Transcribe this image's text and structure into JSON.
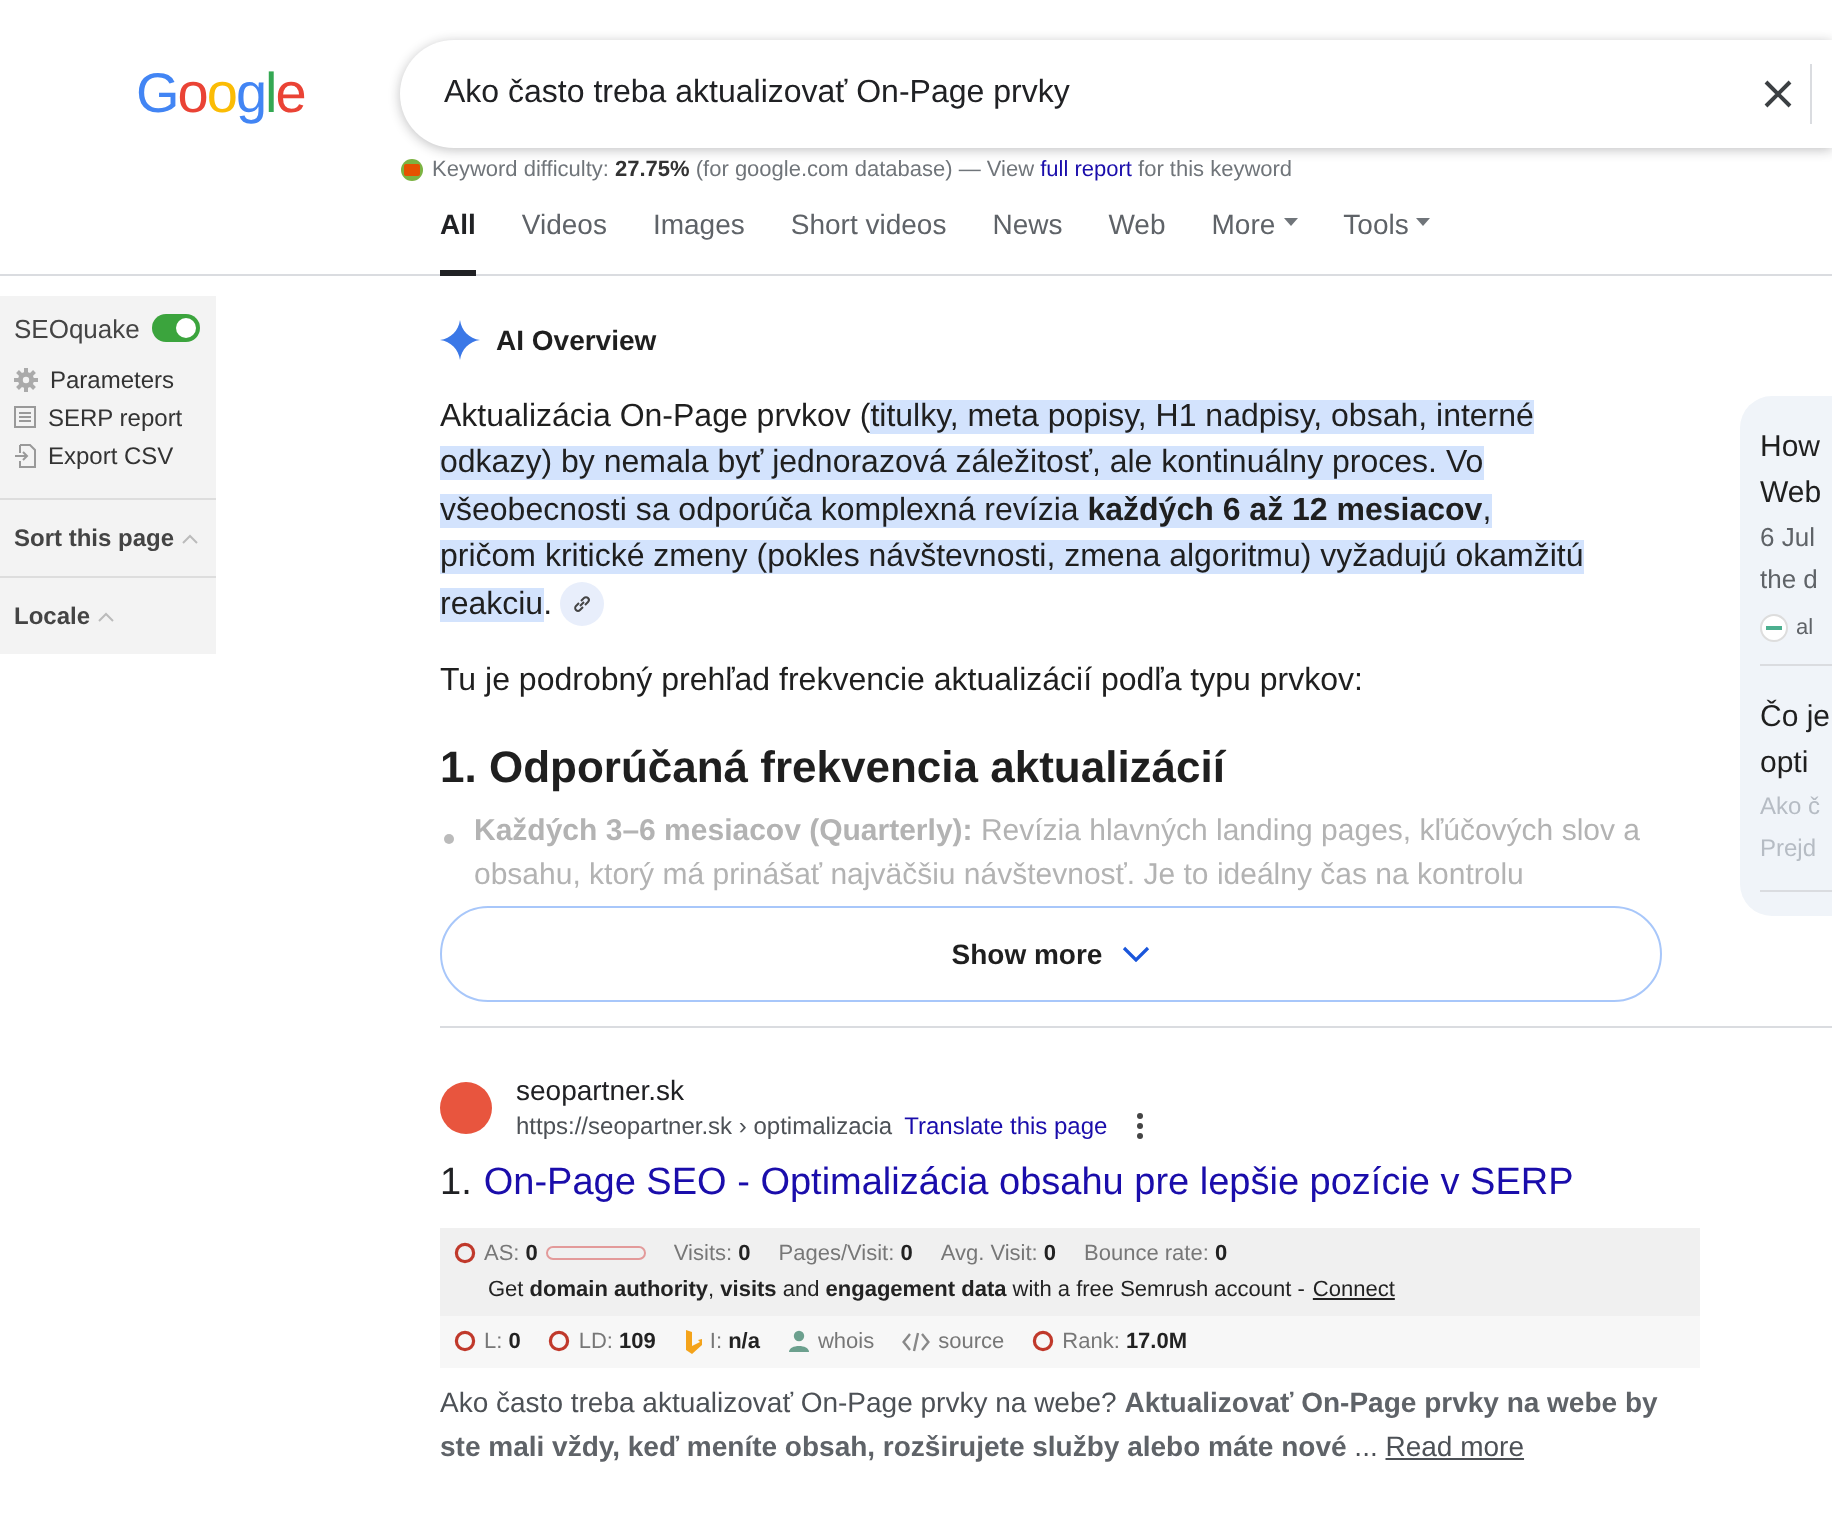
{
  "header": {
    "logo": "Google",
    "query": "Ako často treba aktualizovať On-Page prvky"
  },
  "keyword_difficulty": {
    "before": "Keyword difficulty: **27.75%** (for google.com database) — View",
    "link": "full report",
    "after": "for this keyword"
  },
  "tabs": [
    {
      "label": "All",
      "selected": true,
      "kind": "plain"
    },
    {
      "label": "Videos",
      "selected": false,
      "kind": "plain"
    },
    {
      "label": "Images",
      "selected": false,
      "kind": "plain"
    },
    {
      "label": "Short videos",
      "selected": false,
      "kind": "plain"
    },
    {
      "label": "News",
      "selected": false,
      "kind": "plain"
    },
    {
      "label": "Web",
      "selected": false,
      "kind": "plain"
    },
    {
      "label": "More",
      "selected": false,
      "kind": "dropdown"
    },
    {
      "label": "Tools",
      "selected": false,
      "kind": "dropdown"
    }
  ],
  "seoquake_panel": {
    "title": "SEOquake",
    "on": true,
    "items": [
      {
        "label": "Parameters",
        "kind": "gear"
      },
      {
        "label": "SERP report",
        "kind": "list"
      },
      {
        "label": "Export CSV",
        "kind": "export"
      }
    ],
    "sections": [
      {
        "label": "Sort this page"
      },
      {
        "label": "Locale"
      }
    ]
  },
  "ai_overview": {
    "title": "AI Overview",
    "paragraph": [
      {
        "text": "Aktualizácia On-Page prvkov (",
        "highlighted": false
      },
      {
        "text": "titulky, meta popisy, H1 nadpisy, obsah, interné odkazy) by nemala byť jednorazová záležitosť, ale kontinuálny proces. Vo všeobecnosti sa odporúča komplexná revízia **každých 6 až 12 mesiacov**, pričom kritické zmeny (pokles návštevnosti, zmena algoritmu) vyžadujú okamžitú reakciu",
        "highlighted": true
      },
      {
        "text": ".",
        "highlighted": false
      }
    ],
    "intro": "Tu je podrobný prehľad frekvencie aktualizácií podľa typu prvkov:",
    "heading": "1. Odporúčaná frekvencia aktualizácií",
    "bullet": "**Každých 3–6 mesiacov (Quarterly):** Revízia hlavných landing pages, kľúčových slov a obsahu, ktorý má prinášať najväčšiu návštevnosť. Je to ideálny čas na kontrolu",
    "show_more": "Show more"
  },
  "side_cards": [
    {
      "lines": [
        {
          "kind": "title",
          "text": "How"
        },
        {
          "kind": "title",
          "text": "Web"
        },
        {
          "kind": "meta",
          "text": "6 Jul"
        },
        {
          "kind": "meta",
          "text": "the d"
        },
        {
          "kind": "source",
          "text": "al"
        }
      ]
    },
    {
      "lines": [
        {
          "kind": "title",
          "text": "Čo je"
        },
        {
          "kind": "title",
          "text": "opti"
        },
        {
          "kind": "faded",
          "text": "Ako č"
        },
        {
          "kind": "faded",
          "text": "Prejd"
        }
      ]
    }
  ],
  "result": {
    "site": "seopartner.sk",
    "url": "https://seopartner.sk › optimalizacia",
    "translate": "Translate this page",
    "number": "1.",
    "title": "On-Page SEO - Optimalizácia obsahu pre lepšie pozície v SERP",
    "metrics_top": [
      {
        "label": "AS:",
        "value": "0",
        "kind": "bar",
        "level": 0
      },
      {
        "label": "Visits:",
        "value": "0",
        "kind": "plain"
      },
      {
        "label": "Pages/Visit:",
        "value": "0",
        "kind": "plain"
      },
      {
        "label": "Avg. Visit:",
        "value": "0",
        "kind": "plain"
      },
      {
        "label": "Bounce rate:",
        "value": "0",
        "kind": "plain"
      }
    ],
    "promo": "Get **domain authority**, **visits** and **engagement data** with a free Semrush account -",
    "promo_link": "Connect",
    "metrics_bottom": [
      {
        "label": "L:",
        "value": "0",
        "kind": "circle"
      },
      {
        "label": "LD:",
        "value": "109",
        "kind": "circle"
      },
      {
        "label": "I:",
        "value": "n/a",
        "kind": "bing"
      },
      {
        "label": "whois",
        "kind": "person"
      },
      {
        "label": "source",
        "kind": "code"
      },
      {
        "label": "Rank:",
        "value": "17.0M",
        "kind": "circle"
      }
    ],
    "snippet": "Ako často treba aktualizovať On-Page prvky na webe? **Aktualizovať On-Page prvky na webe by ste mali vždy, keď meníte obsah, rozširujete služby alebo máte nové** ...",
    "read_more": "Read more"
  }
}
